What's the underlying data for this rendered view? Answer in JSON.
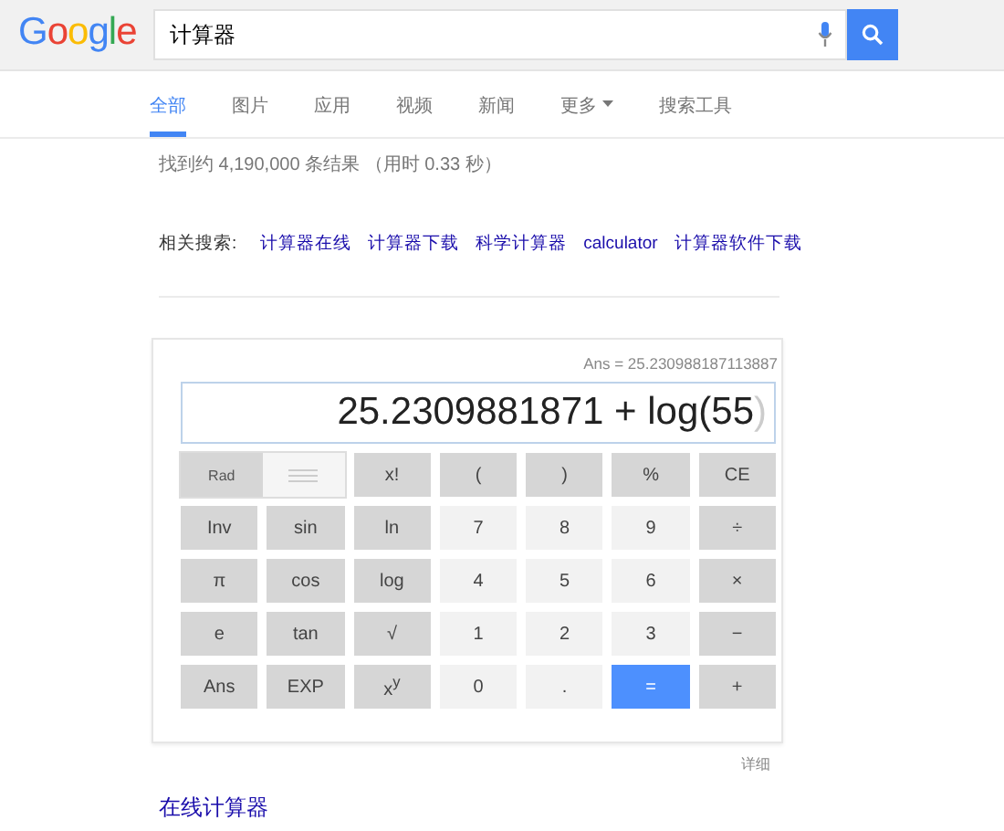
{
  "header": {
    "logo": "Google",
    "query": "计算器"
  },
  "tabs": [
    {
      "label": "全部",
      "selected": true
    },
    {
      "label": "图片",
      "selected": false
    },
    {
      "label": "应用",
      "selected": false
    },
    {
      "label": "视频",
      "selected": false
    },
    {
      "label": "新闻",
      "selected": false
    },
    {
      "label": "更多",
      "selected": false,
      "kind": "menu"
    },
    {
      "label": "搜索工具",
      "selected": false
    }
  ],
  "result_stats": "找到约 4,190,000 条结果 （用时 0.33 秒）",
  "related": {
    "label": "相关搜索:",
    "links": [
      "计算器在线",
      "计算器下载",
      "科学计算器",
      "calculator",
      "计算器软件下载"
    ]
  },
  "calculator": {
    "ans": "Ans = 25.230988187113887",
    "expression": "25.2309881871 + log(55",
    "closing": ")",
    "keys": [
      {
        "label": "Rad",
        "kind": "toggle",
        "selected": true
      },
      {
        "label": "x!",
        "kind": "func"
      },
      {
        "label": "(",
        "kind": "func"
      },
      {
        "label": ")",
        "kind": "func"
      },
      {
        "label": "%",
        "kind": "func"
      },
      {
        "label": "CE",
        "kind": "func"
      },
      {
        "label": "Inv",
        "kind": "func"
      },
      {
        "label": "sin",
        "kind": "func"
      },
      {
        "label": "ln",
        "kind": "func"
      },
      {
        "label": "7",
        "kind": "num"
      },
      {
        "label": "8",
        "kind": "num"
      },
      {
        "label": "9",
        "kind": "num"
      },
      {
        "label": "÷",
        "kind": "func"
      },
      {
        "label": "π",
        "kind": "func"
      },
      {
        "label": "cos",
        "kind": "func"
      },
      {
        "label": "log",
        "kind": "func"
      },
      {
        "label": "4",
        "kind": "num"
      },
      {
        "label": "5",
        "kind": "num"
      },
      {
        "label": "6",
        "kind": "num"
      },
      {
        "label": "×",
        "kind": "func"
      },
      {
        "label": "e",
        "kind": "func"
      },
      {
        "label": "tan",
        "kind": "func"
      },
      {
        "label": "√",
        "kind": "func"
      },
      {
        "label": "1",
        "kind": "num"
      },
      {
        "label": "2",
        "kind": "num"
      },
      {
        "label": "3",
        "kind": "num"
      },
      {
        "label": "−",
        "kind": "func"
      },
      {
        "label": "Ans",
        "kind": "func"
      },
      {
        "label": "EXP",
        "kind": "func"
      },
      {
        "label": "x$^{y}$",
        "kind": "func"
      },
      {
        "label": "0",
        "kind": "num"
      },
      {
        "label": ".",
        "kind": "num"
      },
      {
        "label": "=",
        "kind": "equals"
      },
      {
        "label": "+",
        "kind": "func"
      }
    ]
  },
  "details_link": "详细",
  "result_title": "在线计算器"
}
